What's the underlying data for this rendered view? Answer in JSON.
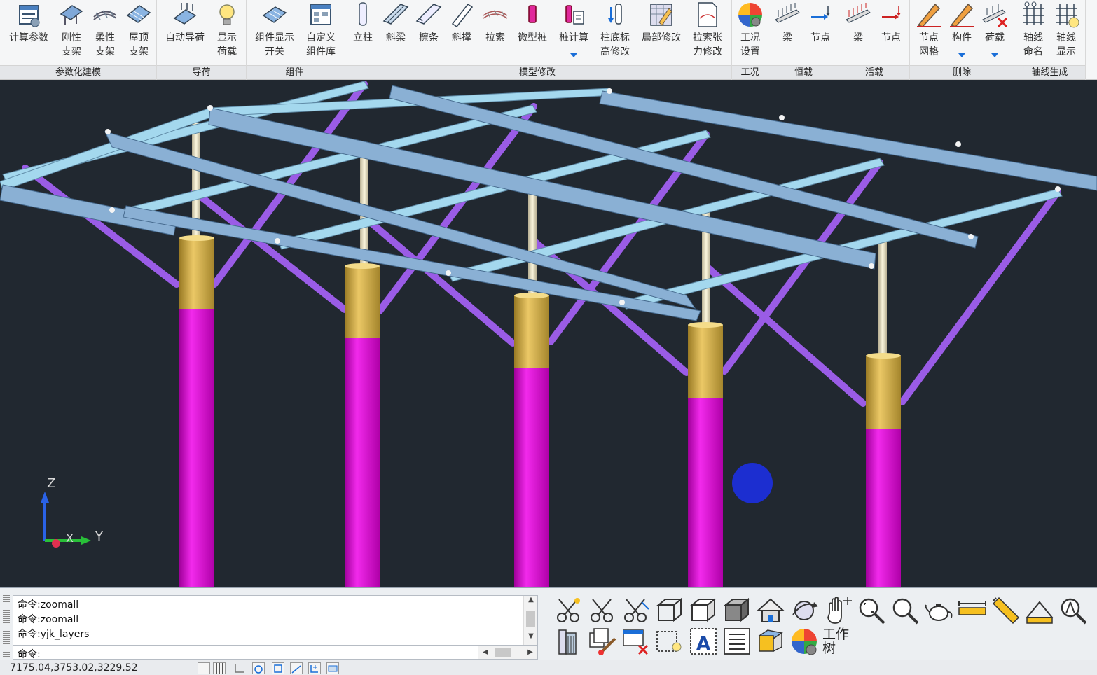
{
  "ribbon": {
    "groups": [
      {
        "label": "参数化建模",
        "buttons": [
          {
            "label": "计算参数",
            "icon": "calc-params-icon"
          },
          {
            "label": "刚性\n支架",
            "icon": "rigid-bracket-icon"
          },
          {
            "label": "柔性\n支架",
            "icon": "flexible-bracket-icon"
          },
          {
            "label": "屋顶\n支架",
            "icon": "roof-bracket-icon"
          }
        ]
      },
      {
        "label": "导荷",
        "buttons": [
          {
            "label": "自动导荷",
            "icon": "auto-load-icon"
          },
          {
            "label": "显示\n荷载",
            "icon": "show-load-icon"
          }
        ]
      },
      {
        "label": "组件",
        "buttons": [
          {
            "label": "组件显示\n开关",
            "icon": "component-display-icon"
          },
          {
            "label": "自定义\n组件库",
            "icon": "custom-library-icon"
          }
        ]
      },
      {
        "label": "模型修改",
        "buttons": [
          {
            "label": "立柱",
            "icon": "column-icon"
          },
          {
            "label": "斜梁",
            "icon": "inclined-beam-icon"
          },
          {
            "label": "檩条",
            "icon": "purlin-icon"
          },
          {
            "label": "斜撑",
            "icon": "brace-icon"
          },
          {
            "label": "拉索",
            "icon": "cable-icon"
          },
          {
            "label": "微型桩",
            "icon": "micro-pile-icon"
          },
          {
            "label": "桩计算",
            "icon": "pile-calc-icon",
            "dropdown": true
          },
          {
            "label": "柱底标\n高修改",
            "icon": "column-base-icon"
          },
          {
            "label": "局部修改",
            "icon": "local-modify-icon"
          },
          {
            "label": "拉索张\n力修改",
            "icon": "cable-tension-icon"
          }
        ]
      },
      {
        "label": "工况",
        "buttons": [
          {
            "label": "工况\n设置",
            "icon": "load-case-icon"
          }
        ]
      },
      {
        "label": "恒载",
        "buttons": [
          {
            "label": "梁",
            "icon": "dead-beam-icon"
          },
          {
            "label": "节点",
            "icon": "dead-node-icon"
          }
        ]
      },
      {
        "label": "活载",
        "buttons": [
          {
            "label": "梁",
            "icon": "live-beam-icon"
          },
          {
            "label": "节点",
            "icon": "live-node-icon"
          }
        ]
      },
      {
        "label": "删除",
        "buttons": [
          {
            "label": "节点\n网格",
            "icon": "delete-node-icon"
          },
          {
            "label": "构件",
            "icon": "delete-member-icon",
            "dropdown": true
          },
          {
            "label": "荷载",
            "icon": "delete-load-icon",
            "dropdown": true
          }
        ]
      },
      {
        "label": "轴线生成",
        "buttons": [
          {
            "label": "轴线\n命名",
            "icon": "axis-name-icon"
          },
          {
            "label": "轴线\n显示",
            "icon": "axis-display-icon"
          }
        ]
      }
    ]
  },
  "viewport": {
    "axis": {
      "z": "Z",
      "x": "X",
      "y": "Y"
    }
  },
  "command": {
    "history": [
      "命令:zoomall",
      "命令:zoomall",
      "命令:yjk_layers"
    ],
    "prompt": "命令:"
  },
  "tools": {
    "work_tree_label": "工作\n树"
  },
  "status": {
    "coords": "7175.04,3753.02,3229.52"
  },
  "colors": {
    "background": "#212830",
    "column": "#e600d9",
    "column_cap": "#d8b448",
    "post": "#ece7c6",
    "beam": "#8ab0d4",
    "purlin": "#a4d8ee",
    "brace": "#9a5ce6",
    "marker": "#1c2ed0"
  }
}
